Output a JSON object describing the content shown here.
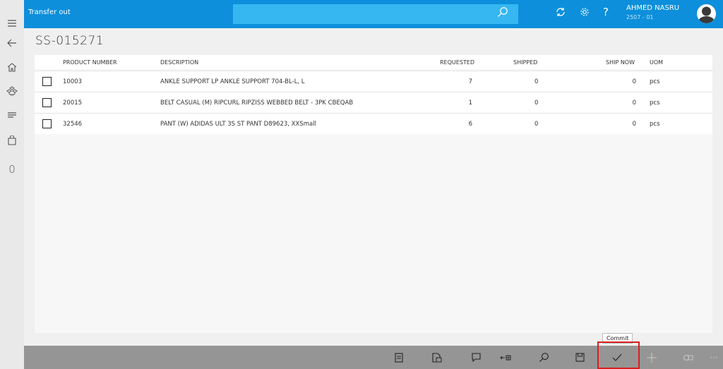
{
  "header": {
    "app_title": "Transfer out",
    "search_placeholder": "",
    "user_name": "AHMED NASRU",
    "user_sub": "2507 - 01"
  },
  "page": {
    "title": "SS-015271"
  },
  "sidebar": {
    "count": "0"
  },
  "table": {
    "columns": {
      "product_number": "PRODUCT NUMBER",
      "description": "DESCRIPTION",
      "requested": "REQUESTED",
      "shipped": "SHIPPED",
      "ship_now": "SHIP NOW",
      "uom": "UOM"
    },
    "rows": [
      {
        "product_number": "10003",
        "description": "ANKLE SUPPORT LP ANKLE SUPPORT 704-BL-L, L",
        "requested": "7",
        "shipped": "0",
        "ship_now": "0",
        "uom": "pcs",
        "checked": false
      },
      {
        "product_number": "20015",
        "description": "BELT CASUAL (M) RIPCURL RIPZISS WEBBED BELT - 3PK CBEQAB",
        "requested": "1",
        "shipped": "0",
        "ship_now": "0",
        "uom": "pcs",
        "checked": false
      },
      {
        "product_number": "32546",
        "description": "PANT (W) ADIDAS ULT 3S ST PANT D89623, XXSmall",
        "requested": "6",
        "shipped": "0",
        "ship_now": "0",
        "uom": "pcs",
        "checked": false
      }
    ]
  },
  "commandbar": {
    "commit_tooltip": "Commit",
    "more_label": "···",
    "icons": [
      "document-list-icon",
      "box-document-icon",
      "note-icon",
      "arrow-grid-icon",
      "search-icon",
      "save-icon",
      "checkmark-icon",
      "plus-icon",
      "multi-item-icon",
      "more-icon"
    ]
  },
  "colors": {
    "header": "#0d8fdb",
    "search": "#36b7f2",
    "commandbar": "#959595",
    "highlight": "#d71f1f"
  }
}
